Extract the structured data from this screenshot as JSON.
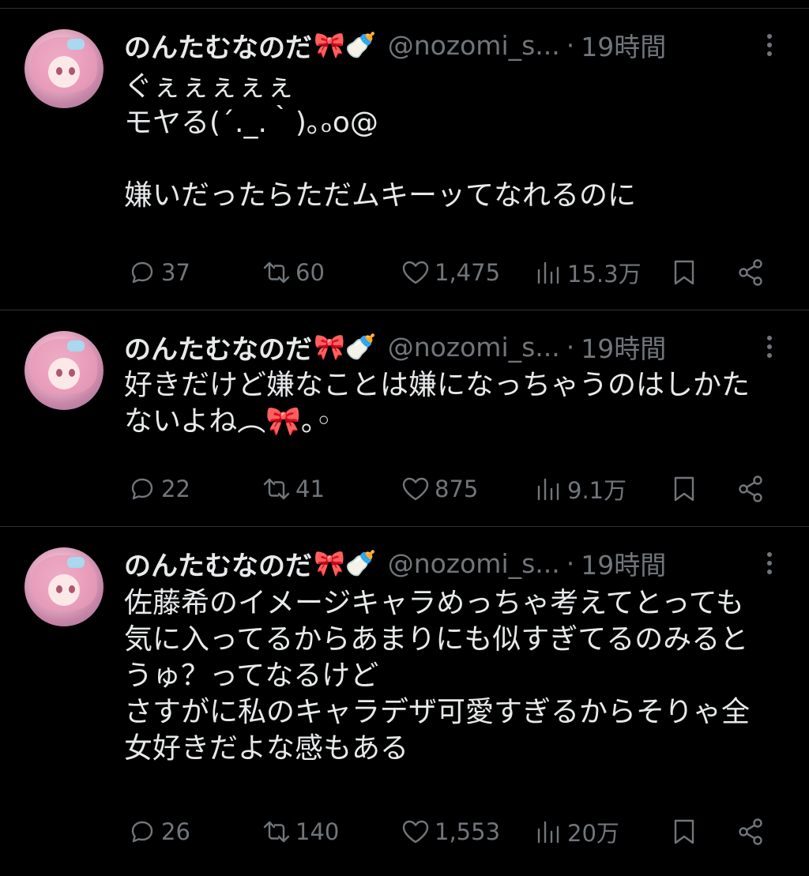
{
  "tweets": [
    {
      "name": "のんたむなのだ",
      "name_emoji": "🎀🍼",
      "handle": "@nozomi_s...",
      "dot": "·",
      "time": "19時間",
      "text": "ぐぇぇぇぇぇ\nモヤる(´._.｀)｡ₒo@\n\n嫌いだったらただムキーッてなれるのに",
      "replies": "37",
      "retweets": "60",
      "likes": "1,475",
      "views": "15.3万"
    },
    {
      "name": "のんたむなのだ",
      "name_emoji": "🎀🍼",
      "handle": "@nozomi_s...",
      "dot": "·",
      "time": "19時間",
      "text": "好きだけど嫌なことは嫌になっちゃうのはしかたないよね︵🎀｡◦",
      "replies": "22",
      "retweets": "41",
      "likes": "875",
      "views": "9.1万"
    },
    {
      "name": "のんたむなのだ",
      "name_emoji": "🎀🍼",
      "handle": "@nozomi_s...",
      "dot": "·",
      "time": "19時間",
      "text": "佐藤希のイメージキャラめっちゃ考えてとっても気に入ってるからあまりにも似すぎてるのみるとうゅ？ってなるけど\nさすがに私のキャラデザ可愛すぎるからそりゃ全女好きだよな感もある",
      "replies": "26",
      "retweets": "140",
      "likes": "1,553",
      "views": "20万"
    }
  ],
  "icons": {
    "reply": "reply-icon",
    "retweet": "retweet-icon",
    "like": "heart-icon",
    "views": "views-chart-icon",
    "bookmark": "bookmark-icon",
    "share": "share-icon",
    "more": "more-dots-icon"
  },
  "colors": {
    "background": "#000000",
    "text": "#e7e9ea",
    "muted": "#71767b",
    "divider": "#2f3336"
  }
}
